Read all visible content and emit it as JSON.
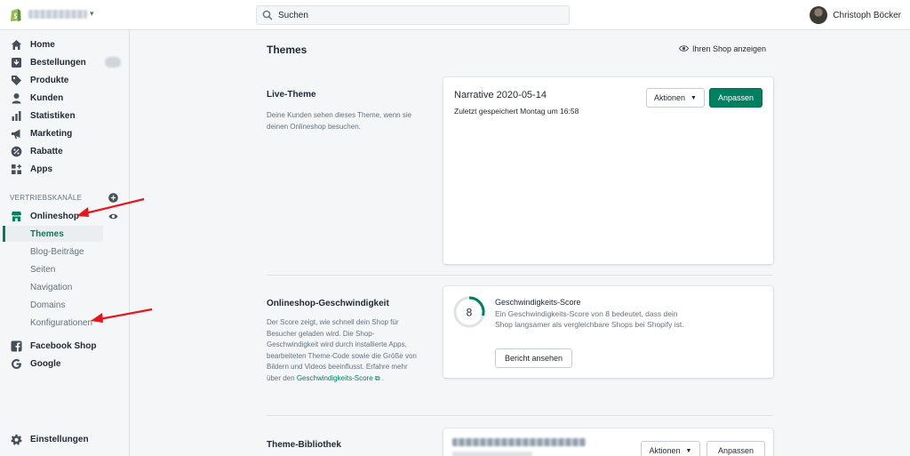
{
  "topbar": {
    "search_placeholder": "Suchen",
    "user_name": "Christoph Böcker"
  },
  "sidebar": {
    "items": [
      {
        "label": "Home",
        "icon": "home-icon"
      },
      {
        "label": "Bestellungen",
        "icon": "orders-icon"
      },
      {
        "label": "Produkte",
        "icon": "tag-icon"
      },
      {
        "label": "Kunden",
        "icon": "person-icon"
      },
      {
        "label": "Statistiken",
        "icon": "bar-chart-icon"
      },
      {
        "label": "Marketing",
        "icon": "megaphone-icon"
      },
      {
        "label": "Rabatte",
        "icon": "discount-icon"
      },
      {
        "label": "Apps",
        "icon": "apps-icon"
      }
    ],
    "channels_label": "VERTRIEBSKANÄLE",
    "onlineshop": {
      "label": "Onlineshop",
      "sub_items": [
        "Themes",
        "Blog-Beiträge",
        "Seiten",
        "Navigation",
        "Domains",
        "Konfigurationen"
      ],
      "active": "Themes"
    },
    "facebook_label": "Facebook Shop",
    "google_label": "Google",
    "settings_label": "Einstellungen"
  },
  "main": {
    "title": "Themes",
    "view_shop": "Ihren Shop anzeigen",
    "live": {
      "title": "Live-Theme",
      "desc": "Deine Kunden sehen dieses Theme, wenn sie deinen Onlineshop besuchen.",
      "theme_name": "Narrative 2020-05-14",
      "saved": "Zuletzt gespeichert Montag um 16:58",
      "actions_label": "Aktionen",
      "customize_label": "Anpassen"
    },
    "speed": {
      "title": "Onlineshop-Geschwindigkeit",
      "desc": "Der Score zeigt, wie schnell dein Shop für Besucher geladen wird. Die Shop-Geschwindigkeit wird durch installierte Apps, bearbeiteten Theme-Code sowie die Größe von Bildern und Videos beeinflusst. Erfahre mehr über den",
      "link": "Geschwindigkeits-Score",
      "score": "8",
      "score_title": "Geschwindigkeits-Score",
      "score_desc": "Ein Geschwindigkeits-Score von 8 bedeutet, dass dein Shop langsamer als vergleichbare Shops bei Shopify ist.",
      "report_label": "Bericht ansehen"
    },
    "library": {
      "title": "Theme-Bibliothek",
      "actions_label": "Aktionen",
      "customize_label": "Anpassen"
    }
  },
  "colors": {
    "accent": "#008060",
    "annotation_arrow": "#e8161b"
  }
}
